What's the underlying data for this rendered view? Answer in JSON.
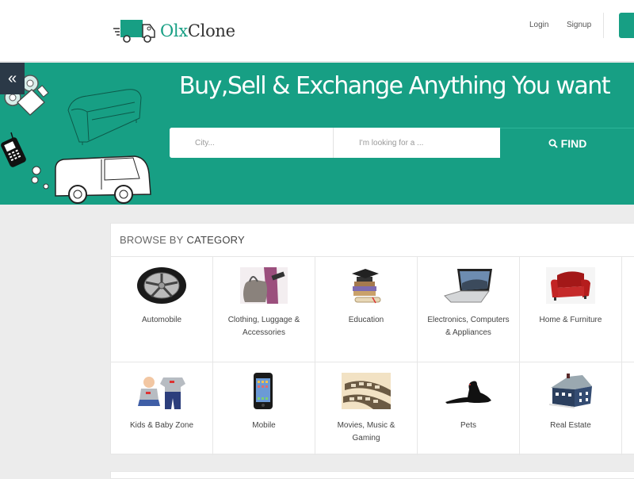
{
  "header": {
    "logo": {
      "brand_primary": "Olx",
      "brand_secondary": "Clone",
      "icon": "truck-icon"
    },
    "nav": {
      "login_label": "Login",
      "signup_label": "Signup"
    }
  },
  "hero": {
    "collapse_icon": "double-chevron-left-icon",
    "collapse_glyph": "«",
    "title": "Buy,Sell & Exchange Anything You want",
    "search": {
      "city_placeholder": "City...",
      "query_placeholder": "I'm looking for a ...",
      "find_label": "FIND",
      "find_icon": "search-icon"
    }
  },
  "categories": {
    "heading_light": "BROWSE BY",
    "heading_bold": "CATEGORY",
    "items": [
      {
        "label": "Automobile",
        "icon": "wheel-icon"
      },
      {
        "label": "Clothing, Luggage & Accessories",
        "icon": "handbag-icon"
      },
      {
        "label": "Education",
        "icon": "books-graduation-cap-icon"
      },
      {
        "label": "Electronics, Computers & Appliances",
        "icon": "laptop-icon"
      },
      {
        "label": "Home & Furniture",
        "icon": "armchair-icon"
      },
      {
        "label": "",
        "icon": ""
      },
      {
        "label": "Kids & Baby Zone",
        "icon": "baby-clothes-icon"
      },
      {
        "label": "Mobile",
        "icon": "smartphone-icon"
      },
      {
        "label": "Movies, Music & Gaming",
        "icon": "film-reel-icon"
      },
      {
        "label": "Pets",
        "icon": "dog-icon"
      },
      {
        "label": "Real Estate",
        "icon": "house-icon"
      },
      {
        "label": "",
        "icon": ""
      }
    ]
  },
  "colors": {
    "brand_green": "#179f84",
    "collapse_bg": "#2b3947",
    "page_bg": "#ececec"
  }
}
